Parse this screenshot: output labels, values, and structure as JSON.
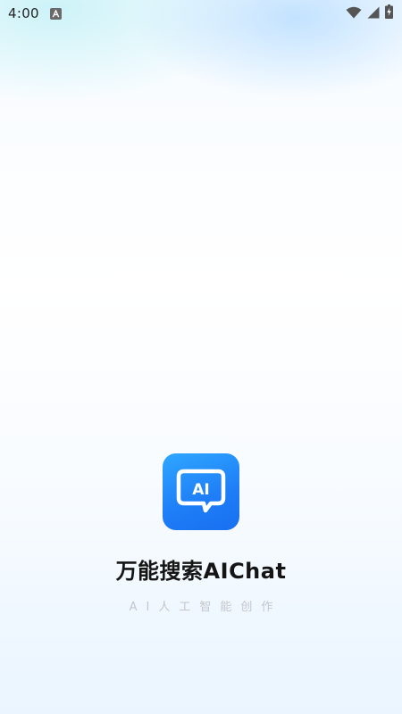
{
  "status_bar": {
    "time": "4:00",
    "notification_icon": "accessibility-a-icon",
    "wifi_icon": "wifi-icon",
    "signal_icon": "cellular-signal-icon",
    "battery_icon": "battery-charging-icon"
  },
  "splash": {
    "app_icon": "ai-chat-bubble-icon",
    "app_icon_text": "AI",
    "title": "万能搜索AIChat",
    "subtitle": "AI人工智能创作"
  },
  "colors": {
    "icon_gradient_start": "#2fa7ff",
    "icon_gradient_end": "#1870f0",
    "title": "#151515",
    "subtitle": "#c4c6ca"
  }
}
